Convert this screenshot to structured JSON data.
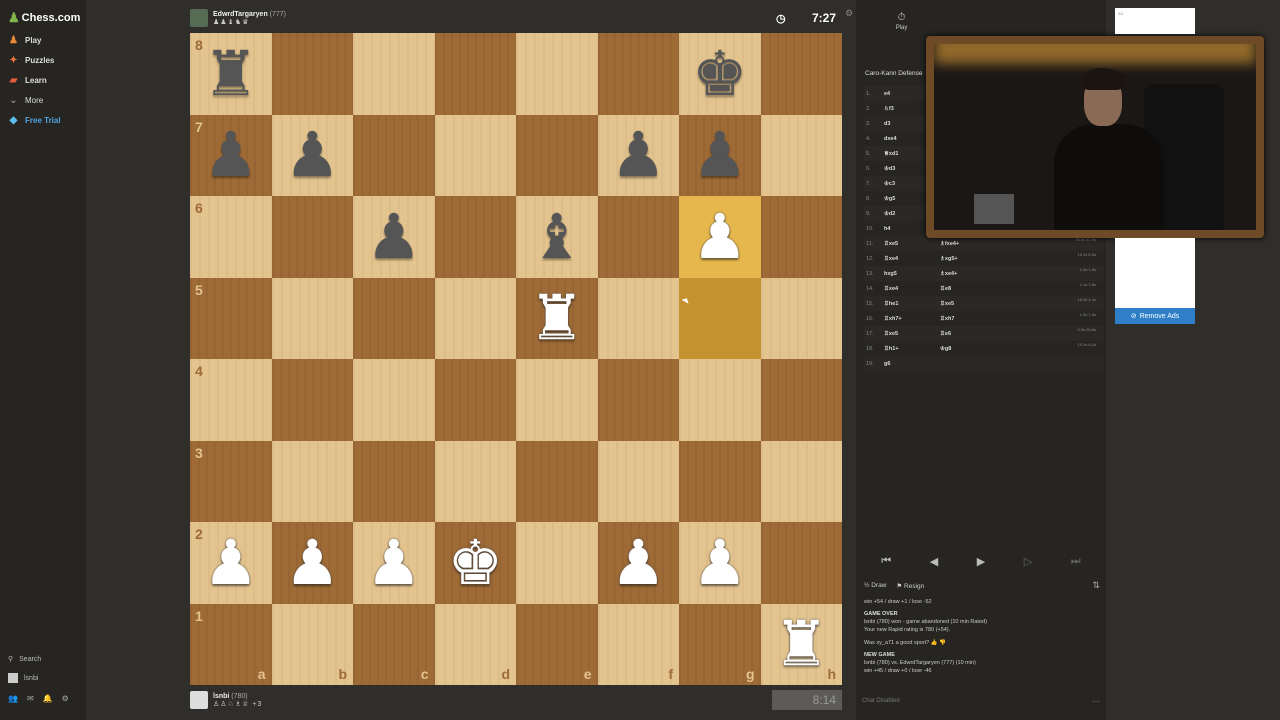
{
  "sidebar": {
    "logo": "Chess.com",
    "items": [
      {
        "label": "Play",
        "icon": "play-icon"
      },
      {
        "label": "Puzzles",
        "icon": "puzzle-icon"
      },
      {
        "label": "Learn",
        "icon": "learn-icon"
      },
      {
        "label": "More",
        "icon": "chevron-down-icon"
      },
      {
        "label": "Free Trial",
        "icon": "diamond-icon"
      }
    ],
    "search_label": "Search",
    "user_label": "lsnbi"
  },
  "top_player": {
    "name": "EdwrdTargaryen",
    "rating": "(777)",
    "captured": "♟♟♝♞♛",
    "clock": "7:27"
  },
  "bottom_player": {
    "name": "lsnbi",
    "rating": "(780)",
    "captured": "♙♙♘♗♕ +3",
    "clock": "8:14"
  },
  "board": {
    "ranks": [
      "8",
      "7",
      "6",
      "5",
      "4",
      "3",
      "2",
      "1"
    ],
    "files": [
      "a",
      "b",
      "c",
      "d",
      "e",
      "f",
      "g",
      "h"
    ],
    "position": [
      [
        "bR",
        "",
        "",
        "",
        "",
        "",
        "bK",
        ""
      ],
      [
        "bP",
        "bP",
        "",
        "",
        "",
        "bP",
        "bP",
        ""
      ],
      [
        "",
        "",
        "bP",
        "",
        "bB",
        "",
        "wP",
        ""
      ],
      [
        "",
        "",
        "",
        "",
        "wR",
        "",
        "",
        ""
      ],
      [
        "",
        "",
        "",
        "",
        "",
        "",
        "",
        ""
      ],
      [
        "",
        "",
        "",
        "",
        "",
        "",
        "",
        ""
      ],
      [
        "wP",
        "wP",
        "wP",
        "wK",
        "",
        "wP",
        "wP",
        ""
      ],
      [
        "",
        "",
        "",
        "",
        "",
        "",
        "",
        "wR"
      ]
    ],
    "highlights": [
      [
        2,
        6
      ],
      [
        3,
        6
      ]
    ]
  },
  "panel": {
    "tabs": [
      {
        "label": "Play",
        "icon": "stopwatch-icon"
      }
    ],
    "opening": "Caro-Kann Defense",
    "moves": [
      {
        "n": "1.",
        "w": "e4",
        "b": "",
        "t": ""
      },
      {
        "n": "2.",
        "w": "♘f3",
        "b": "",
        "t": ""
      },
      {
        "n": "3.",
        "w": "d3",
        "b": "",
        "t": ""
      },
      {
        "n": "4.",
        "w": "dxe4",
        "b": "",
        "t": ""
      },
      {
        "n": "5.",
        "w": "♕xd1",
        "b": "",
        "t": ""
      },
      {
        "n": "6.",
        "w": "♔d3",
        "b": "",
        "t": ""
      },
      {
        "n": "7.",
        "w": "♔c3",
        "b": "",
        "t": ""
      },
      {
        "n": "8.",
        "w": "♔g5",
        "b": "",
        "t": ""
      },
      {
        "n": "9.",
        "w": "♔d2",
        "b": "",
        "t": ""
      },
      {
        "n": "10.",
        "w": "h4",
        "b": "",
        "t": ""
      },
      {
        "n": "11.",
        "w": "♖xe5",
        "b": "♗fxe4+",
        "t": "30.9s 41.9s"
      },
      {
        "n": "12.",
        "w": "♖xe4",
        "b": "♗xg5+",
        "t": "10.2s 5.5s"
      },
      {
        "n": "13.",
        "w": "hxg5",
        "b": "♗xe4+",
        "t": "1.5s 1.9s"
      },
      {
        "n": "14.",
        "w": "♖xe4",
        "b": "♖e8",
        "t": "1.1s 2.8s"
      },
      {
        "n": "15.",
        "w": "♖he1",
        "b": "♖xe5",
        "t": "16.3s 4.4s"
      },
      {
        "n": "16.",
        "w": "♖xh7+",
        "b": "♖xh7",
        "t": "1.5s 1.5s"
      },
      {
        "n": "17.",
        "w": "♖xe5",
        "b": "♖e6",
        "t": "3.5s 26.8s"
      },
      {
        "n": "18.",
        "w": "♖h1+",
        "b": "♔g8",
        "t": "19.2s 8.2s"
      },
      {
        "n": "19.",
        "w": "g6",
        "b": "",
        "t": ""
      }
    ],
    "controls": [
      "⏮",
      "◀",
      "▶",
      "▷",
      "⏭"
    ],
    "draw_label": "Draw",
    "resign_label": "Resign",
    "chat_disabled": "Chat Disabled"
  },
  "chat": {
    "line0": "win +54 / draw +1 / lose -52",
    "game_over_title": "GAME OVER",
    "game_over_line1": "lsnbi (780) won - game abandoned (10 min Rated)",
    "game_over_line2": "Your new Rapid rating is 780 (+54).",
    "sport_q": "Was xy_a71 a good sport?",
    "new_game_title": "NEW GAME",
    "new_game_line1": "lsnbi (780) vs. EdwrdTargaryen (777) (10 min)",
    "new_game_line2": "win +45 / draw +0 / lose -46"
  },
  "ads": {
    "label": "AD",
    "remove_label": "Remove Ads"
  }
}
